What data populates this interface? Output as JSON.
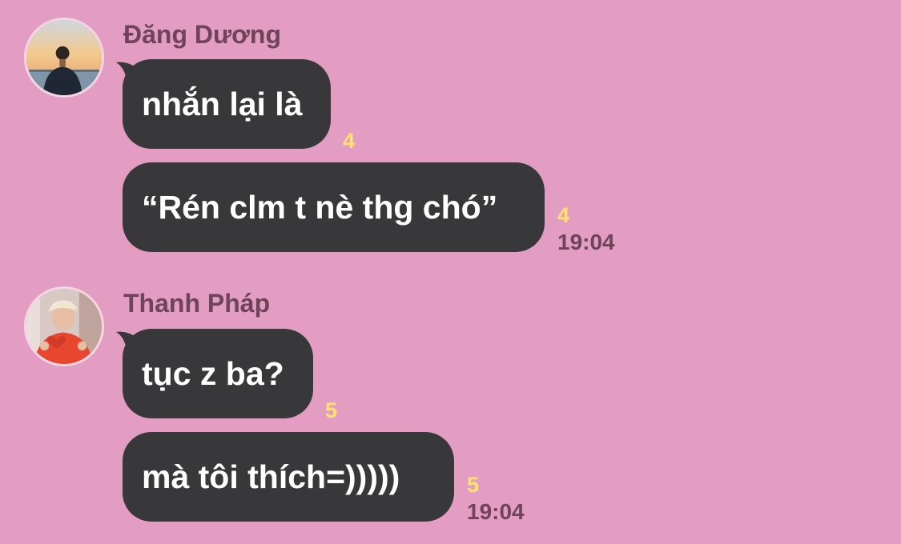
{
  "colors": {
    "background": "#e49dc2",
    "bubble": "#38383a",
    "bubble_text": "#ffffff",
    "sender_name": "#6e4458",
    "read_count": "#ffe36a",
    "timestamp": "#6e4458"
  },
  "messages": [
    {
      "sender": "Đăng Dương",
      "avatar_icon": "user-avatar-icon",
      "bubbles": [
        {
          "text": "nhắn lại là",
          "read_count": "4",
          "time": ""
        },
        {
          "text": "“Rén clm t nè thg chó”",
          "read_count": "4",
          "time": "19:04"
        }
      ]
    },
    {
      "sender": "Thanh Pháp",
      "avatar_icon": "user-avatar-icon",
      "bubbles": [
        {
          "text": "tục z ba?",
          "read_count": "5",
          "time": ""
        },
        {
          "text": "mà tôi thích=)))))",
          "read_count": "5",
          "time": "19:04"
        }
      ]
    }
  ]
}
